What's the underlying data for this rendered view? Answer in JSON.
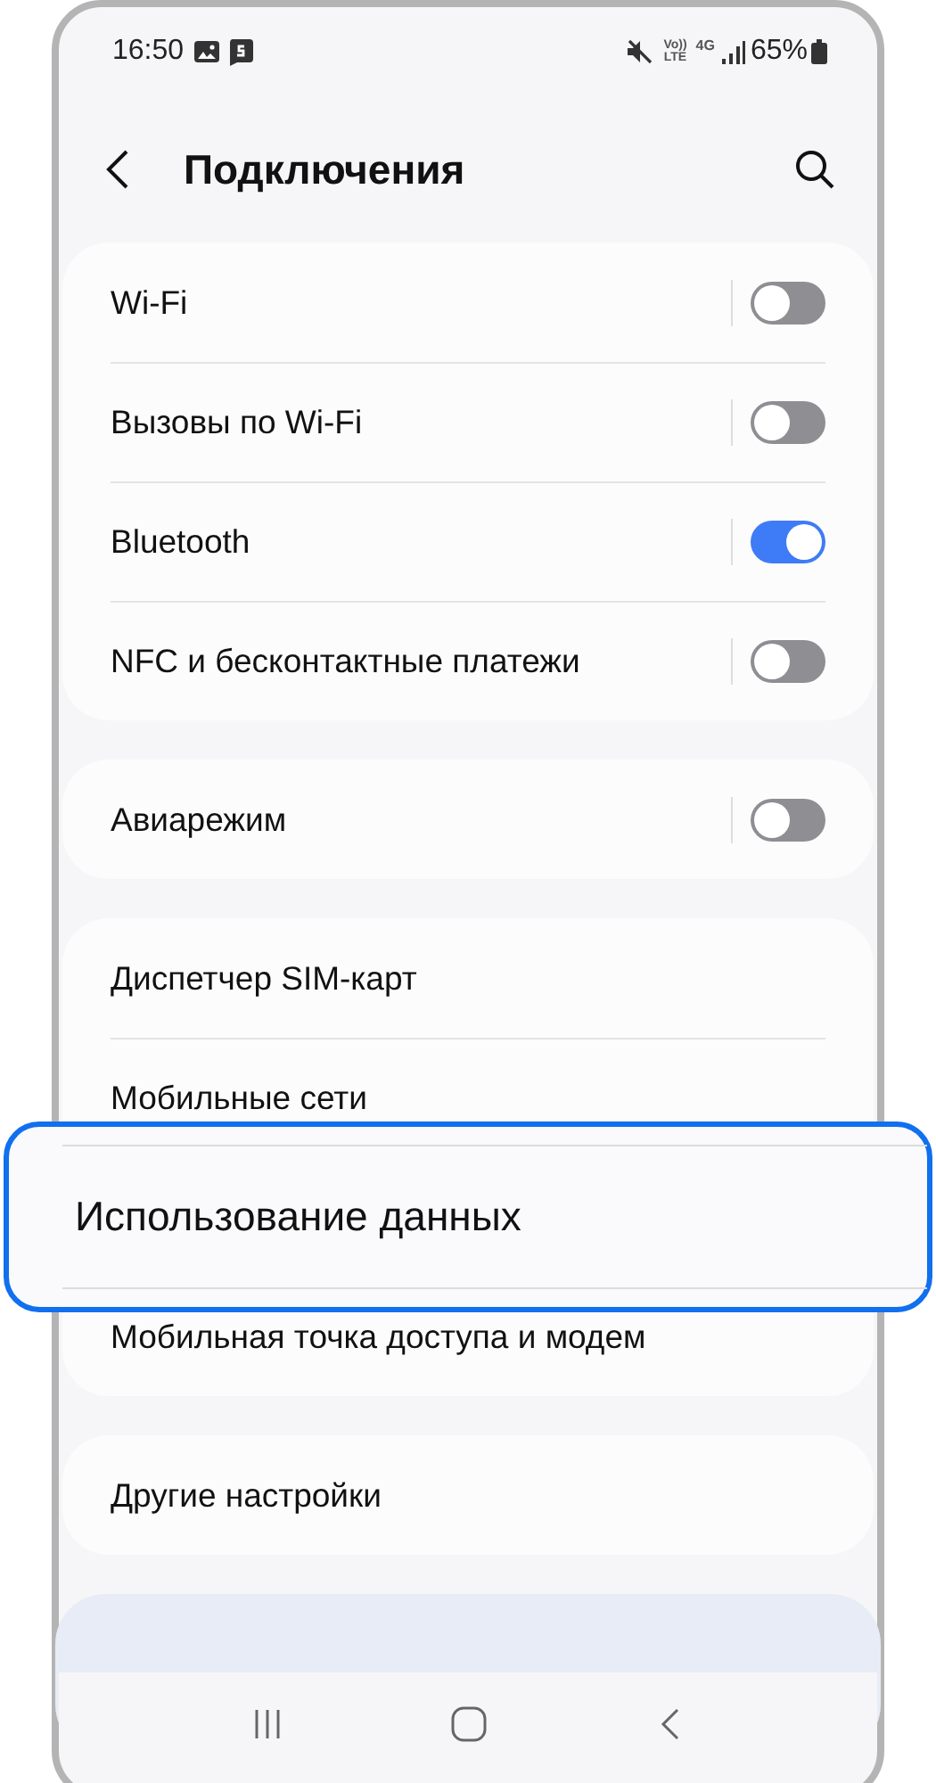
{
  "status_bar": {
    "time": "16:50",
    "volte_top": "Vo))",
    "volte_bottom": "LTE",
    "network": "4G",
    "battery": "65%"
  },
  "header": {
    "title": "Подключения"
  },
  "sections": [
    {
      "items": [
        {
          "label": "Wi-Fi",
          "kind": "toggle",
          "on": false
        },
        {
          "label": "Вызовы по Wi-Fi",
          "kind": "toggle",
          "on": false
        },
        {
          "label": "Bluetooth",
          "kind": "toggle",
          "on": true
        },
        {
          "label": "NFC и бесконтактные платежи",
          "kind": "toggle",
          "on": false
        }
      ]
    },
    {
      "items": [
        {
          "label": "Авиарежим",
          "kind": "toggle",
          "on": false
        }
      ]
    },
    {
      "items": [
        {
          "label": "Диспетчер SIM-карт",
          "kind": "link",
          "highlighted": false
        },
        {
          "label": "Мобильные сети",
          "kind": "link",
          "highlighted": false
        },
        {
          "label": "Использование данных",
          "kind": "link",
          "highlighted": true
        },
        {
          "label": "Мобильная точка доступа и модем",
          "kind": "link",
          "highlighted": false
        }
      ]
    },
    {
      "items": [
        {
          "label": "Другие настройки",
          "kind": "link",
          "highlighted": false
        }
      ]
    },
    {
      "kind": "tip"
    }
  ]
}
